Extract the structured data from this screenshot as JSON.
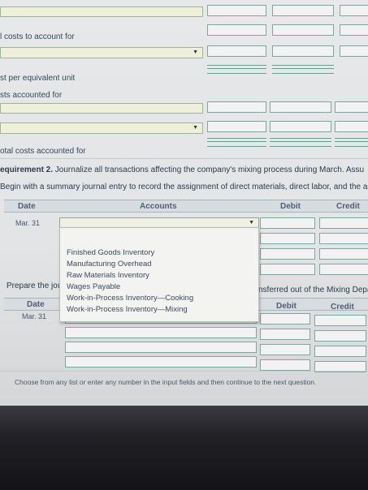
{
  "top": {
    "label_costs_to_account": "l costs to account for",
    "label_cost_per_unit": "st per equivalent unit",
    "label_costs_accounted": "sts accounted for",
    "label_total_accounted": "otal costs accounted for"
  },
  "requirement": {
    "title": "equirement 2.",
    "text": " Journalize all transactions affecting the company's mixing process during March. Assu",
    "instruction": "Begin with a summary journal entry to record the assignment of direct materials, direct labor, and the al"
  },
  "journal1": {
    "headers": {
      "date": "Date",
      "accounts": "Accounts",
      "debit": "Debit",
      "credit": "Credit"
    },
    "date_value": "Mar. 31"
  },
  "dropdown_menu": {
    "items": [
      "Finished Goods Inventory",
      "Manufacturing Overhead",
      "Raw Materials Inventory",
      "Wages Payable",
      "Work-in-Process Inventory—Cooking",
      "Work-in-Process Inventory—Mixing"
    ]
  },
  "prepare": {
    "left_text": "Prepare the journ",
    "right_text": "nsferred out of the Mixing Depa"
  },
  "journal2": {
    "headers": {
      "date": "Date",
      "debit": "Debit",
      "credit": "Credit"
    },
    "date_value": "Mar. 31"
  },
  "footer": {
    "hint": "Choose from any list or enter any number in the input fields and then continue to the next question."
  }
}
